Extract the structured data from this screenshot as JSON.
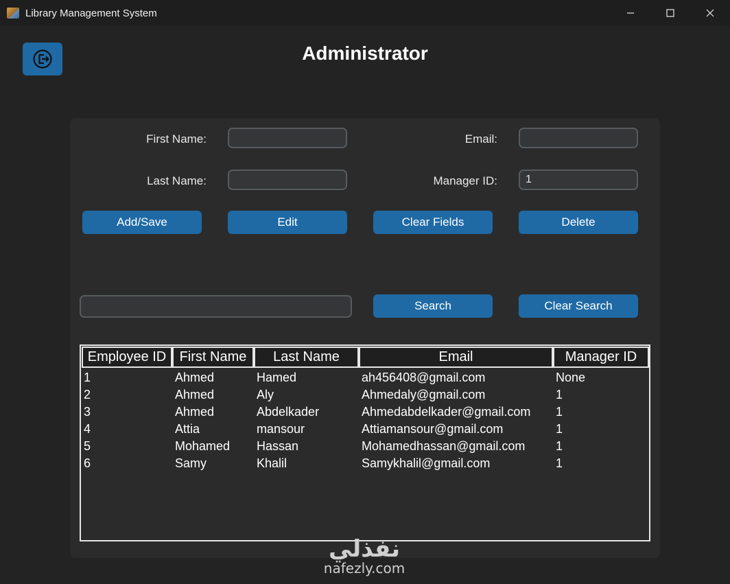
{
  "window": {
    "title": "Library Management System"
  },
  "page": {
    "title": "Administrator"
  },
  "form": {
    "first_name_label": "First Name:",
    "last_name_label": "Last Name:",
    "email_label": "Email:",
    "manager_id_label": "Manager ID:",
    "first_name_value": "",
    "last_name_value": "",
    "email_value": "",
    "manager_id_value": "1"
  },
  "buttons": {
    "add_save": "Add/Save",
    "edit": "Edit",
    "clear_fields": "Clear Fields",
    "delete": "Delete",
    "search": "Search",
    "clear_search": "Clear Search"
  },
  "search": {
    "value": ""
  },
  "table": {
    "columns": [
      "Employee ID",
      "First Name",
      "Last Name",
      "Email",
      "Manager ID"
    ],
    "rows": [
      [
        "1",
        "Ahmed",
        "Hamed",
        "ah456408@gmail.com",
        "None"
      ],
      [
        "2",
        "Ahmed",
        "Aly",
        "Ahmedaly@gmail.com",
        "1"
      ],
      [
        "3",
        "Ahmed",
        "Abdelkader",
        "Ahmedabdelkader@gmail.com",
        "1"
      ],
      [
        "4",
        "Attia",
        "mansour",
        "Attiamansour@gmail.com",
        "1"
      ],
      [
        "5",
        "Mohamed",
        "Hassan",
        "Mohamedhassan@gmail.com",
        "1"
      ],
      [
        "6",
        "Samy",
        "Khalil",
        "Samykhalil@gmail.com",
        "1"
      ]
    ]
  },
  "watermark": {
    "arabic": "نفذلي",
    "latin": "nafezly.com"
  },
  "icons": {
    "logout": "logout-icon",
    "minimize": "minimize-icon",
    "maximize": "maximize-icon",
    "close": "close-icon"
  },
  "colors": {
    "accent": "#1f6aa5",
    "background": "#232323",
    "panel": "#2b2b2b"
  }
}
